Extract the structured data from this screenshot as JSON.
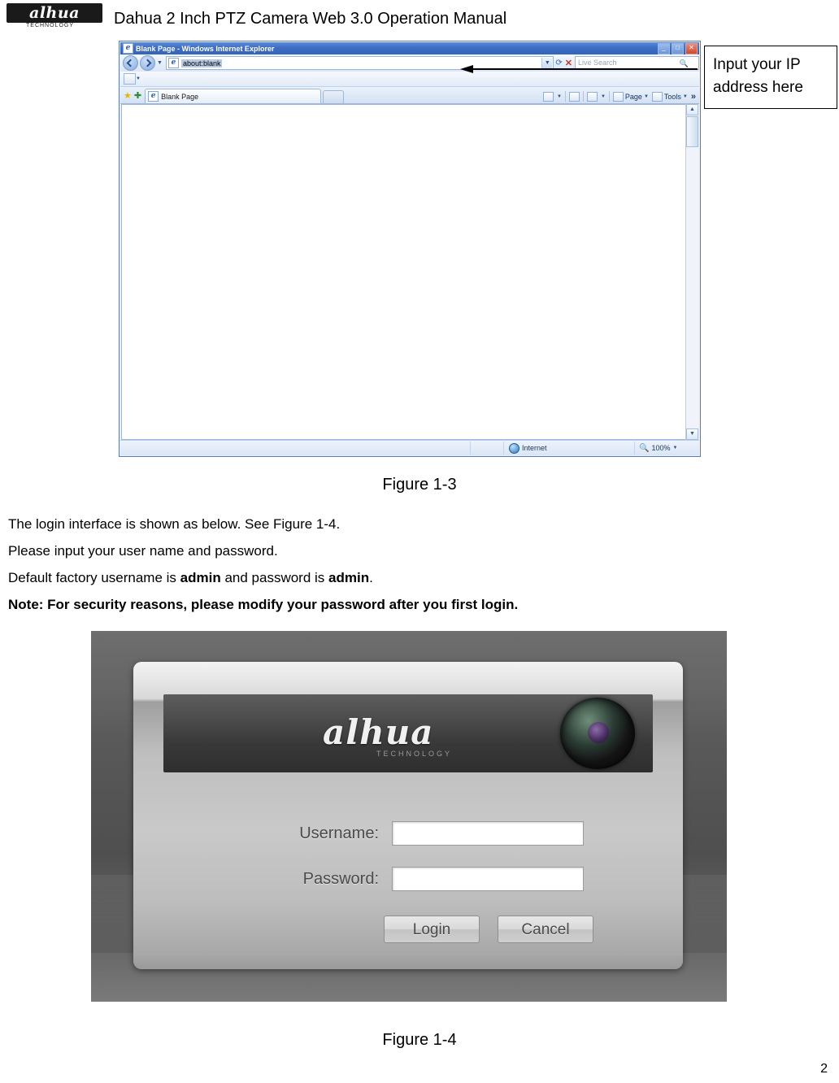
{
  "header": {
    "logo_text": "alhua",
    "logo_sub": "TECHNOLOGY",
    "manual_title": "Dahua 2 Inch PTZ Camera Web 3.0 Operation Manual"
  },
  "figure13": {
    "browser": {
      "title": "Blank Page - Windows Internet Explorer",
      "title_icon": "e",
      "minimize_label": "_",
      "maximize_label": "□",
      "close_label": "✕",
      "address_value": "about:blank",
      "address_icon": "e",
      "search_placeholder": "Live Search",
      "tab_label": "Blank Page",
      "tab_icon": "e",
      "toolbar_items": [
        {
          "label": "Page",
          "icon": "page-icon"
        },
        {
          "label": "Tools",
          "icon": "tools-icon"
        }
      ],
      "overflow_label": "»",
      "status_zone": "Internet",
      "status_zoom": "100%"
    },
    "callout_line1": "Input your IP",
    "callout_line2": "address here",
    "caption": "Figure 1-3"
  },
  "body": {
    "line1": "The login interface is shown as below. See Figure 1-4.",
    "line2": "Please input your user name and password.",
    "line3_a": "Default factory username is ",
    "line3_b": "admin",
    "line3_c": " and password is ",
    "line3_d": "admin",
    "line3_e": ".",
    "line4": "Note: For security reasons, please modify your password after you first login."
  },
  "figure14": {
    "banner_logo": "alhua",
    "banner_sub": "TECHNOLOGY",
    "username_label": "Username:",
    "password_label": "Password:",
    "username_value": "",
    "password_value": "",
    "login_button": "Login",
    "cancel_button": "Cancel",
    "caption": "Figure 1-4"
  },
  "footer": {
    "page_number": "2"
  }
}
